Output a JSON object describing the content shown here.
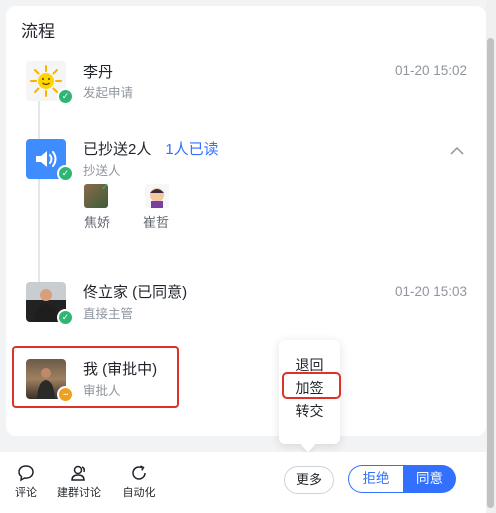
{
  "section_title": "流程",
  "steps": [
    {
      "name": "李丹",
      "role": "发起申请",
      "time": "01-20 15:02"
    },
    {
      "name": "已抄送2人",
      "read_status": "1人已读",
      "role": "抄送人"
    },
    {
      "name": "佟立家 (已同意)",
      "role": "直接主管",
      "time": "01-20 15:03"
    },
    {
      "name": "我 (审批中)",
      "role": "审批人"
    }
  ],
  "cc_people": [
    {
      "name": "焦娇"
    },
    {
      "name": "崔哲"
    }
  ],
  "popup_menu": [
    "退回",
    "加签",
    "转交"
  ],
  "toolbar": {
    "comment": "评论",
    "group": "建群讨论",
    "auto": "自动化"
  },
  "actions": {
    "more": "更多",
    "reject": "拒绝",
    "agree": "同意"
  },
  "colors": {
    "accent": "#3370ff",
    "success": "#2fb576",
    "pending": "#f0a020",
    "highlight": "#e0302a"
  }
}
